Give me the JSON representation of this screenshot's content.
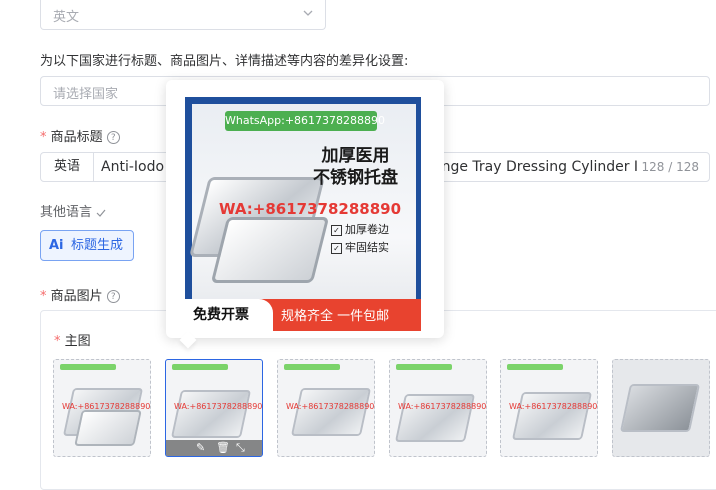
{
  "language_select": {
    "value": "英文"
  },
  "country_section": {
    "heading": "为以下国家进行标题、商品图片、详情描述等内容的差异化设置:",
    "placeholder": "请选择国家"
  },
  "product_title": {
    "label": "商品标题",
    "required_mark": "*",
    "help": "?",
    "lang_prefix": "英语",
    "value_start": "Anti-Iodo",
    "value_end": "ange Tray Dressing Cylinder I",
    "char_count": "128 / 128"
  },
  "other_languages": {
    "label": "其他语言"
  },
  "ai_button": {
    "mark": "Ai",
    "label": "标题生成"
  },
  "product_images": {
    "label": "商品图片",
    "required_mark": "*",
    "help": "?",
    "main_label": "主图",
    "main_required": "*",
    "thumb_count": 6
  },
  "preview": {
    "whatsapp": "WhatsApp:+8617378288890",
    "headline_line1": "加厚医用",
    "headline_line2": "不锈钢托盘",
    "watermark": "WA:+8617378288890",
    "features": [
      "加厚卷边",
      "牢固结实"
    ],
    "bottom_left": "免费开票",
    "bottom_right": "规格齐全 一件包邮"
  },
  "thumb_watermark": "WA:+8617378288890",
  "colors": {
    "primary": "#2c66e3",
    "required": "#f56c6c",
    "border": "#dcdfe6",
    "placeholder": "#a8abb2"
  }
}
